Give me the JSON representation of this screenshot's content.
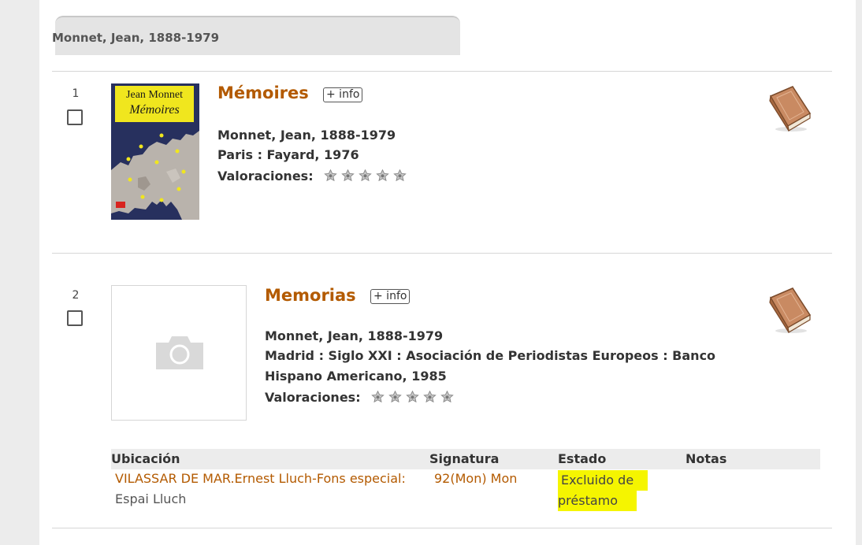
{
  "author_heading": "Monnet, Jean, 1888-1979",
  "results": [
    {
      "number": "1",
      "title": "Mémoires",
      "info_label": "+ info",
      "author": "Monnet, Jean, 1888-1979",
      "publication": "Paris : Fayard, 1976",
      "ratings_label": "Valoraciones:",
      "stars": 0,
      "cover": {
        "author": "Jean Monnet",
        "title": "Mémoires"
      },
      "icon": "book-icon"
    },
    {
      "number": "2",
      "title": "Memorias",
      "info_label": "+ info",
      "author": "Monnet, Jean, 1888-1979",
      "publication_line1": "Madrid : Siglo XXI : Asociación de Periodistas Europeos : Banco",
      "publication_line2": "Hispano Americano, 1985",
      "ratings_label": "Valoraciones:",
      "stars": 0,
      "cover": "camera-icon",
      "icon": "book-icon"
    }
  ],
  "holdings": {
    "headers": [
      "Ubicación",
      "Signatura",
      "Estado",
      "Notas"
    ],
    "row": {
      "location_line1": "VILASSAR DE MAR.Ernest Lluch-Fons especial:",
      "location_line2": "Espai Lluch",
      "signature": "92(Mon) Mon",
      "status_line1": "Excluido de",
      "status_line2": "préstamo",
      "notes": ""
    }
  },
  "colors": {
    "title": "#b35a00",
    "highlight": "#f5f500",
    "page_background": "#ececec"
  }
}
